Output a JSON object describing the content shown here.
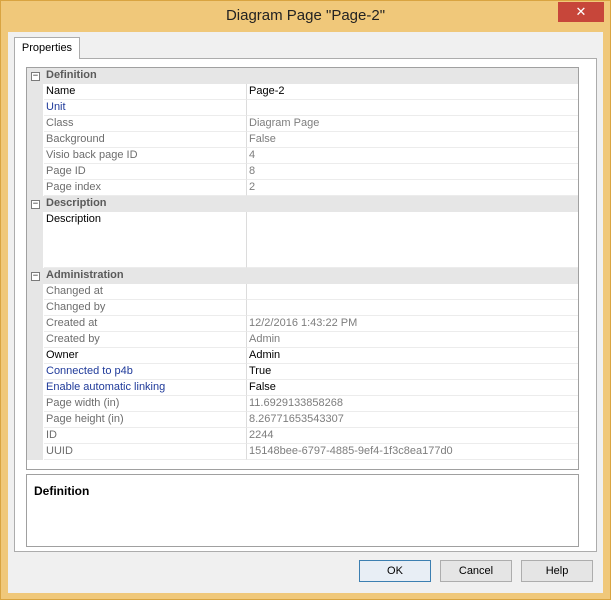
{
  "window": {
    "title": "Diagram Page \"Page-2\"",
    "close_glyph": "✕"
  },
  "tabs": [
    {
      "label": "Properties"
    }
  ],
  "grid": {
    "categories": [
      {
        "label": "Definition",
        "toggle": "−",
        "properties": [
          {
            "name": "Name",
            "value": "Page-2"
          },
          {
            "name": "Unit",
            "value": ""
          },
          {
            "name": "Class",
            "value": "Diagram Page"
          },
          {
            "name": "Background",
            "value": "False"
          },
          {
            "name": "Visio back page ID",
            "value": "4"
          },
          {
            "name": "Page ID",
            "value": "8"
          },
          {
            "name": "Page index",
            "value": "2"
          }
        ]
      },
      {
        "label": "Description",
        "toggle": "−",
        "properties": [
          {
            "name": "Description",
            "value": ""
          }
        ]
      },
      {
        "label": "Administration",
        "toggle": "−",
        "properties": [
          {
            "name": "Changed at",
            "value": ""
          },
          {
            "name": "Changed by",
            "value": ""
          },
          {
            "name": "Created at",
            "value": "12/2/2016 1:43:22 PM"
          },
          {
            "name": "Created by",
            "value": "Admin"
          },
          {
            "name": "Owner",
            "value": "Admin"
          },
          {
            "name": "Connected to p4b",
            "value": "True"
          },
          {
            "name": "Enable automatic linking",
            "value": "False"
          },
          {
            "name": "Page width (in)",
            "value": "11.6929133858268"
          },
          {
            "name": "Page height (in)",
            "value": "8.26771653543307"
          },
          {
            "name": "ID",
            "value": "2244"
          },
          {
            "name": "UUID",
            "value": "15148bee-6797-4885-9ef4-1f3c8ea177d0"
          }
        ]
      }
    ]
  },
  "description_panel": {
    "title": "Definition"
  },
  "buttons": {
    "ok": "OK",
    "cancel": "Cancel",
    "help": "Help"
  },
  "colors": {
    "title_bar": "#f0c87a",
    "close_button": "#c7463a",
    "editable_property": "#1f3a9a",
    "readonly_property": "#6d6d6d"
  }
}
